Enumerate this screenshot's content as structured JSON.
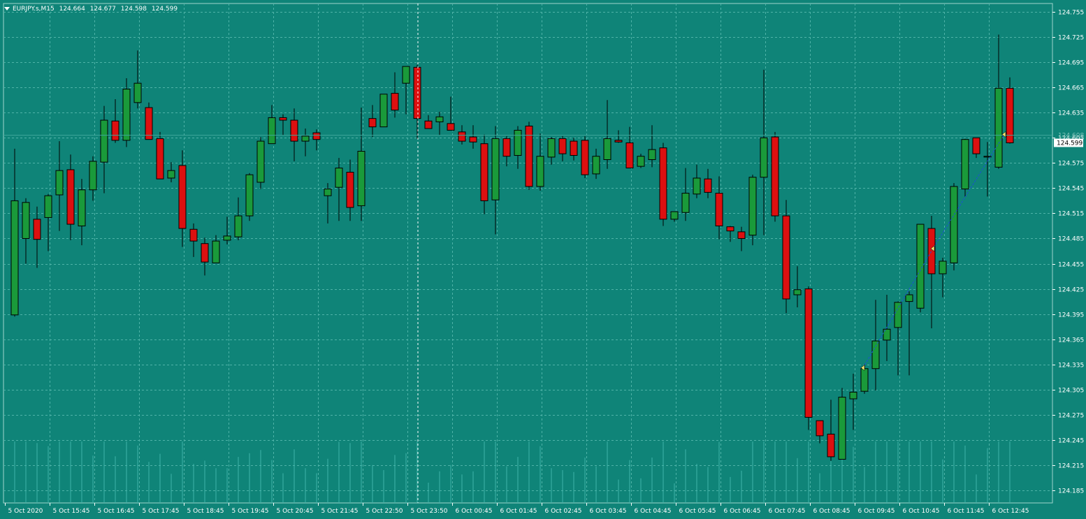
{
  "header": {
    "symbol": "EURJPY.s,M15",
    "open": "124.664",
    "high": "124.677",
    "low": "124.598",
    "close": "124.599"
  },
  "colors": {
    "background": "#0f8478",
    "bull": "#1a9a3a",
    "bear": "#dc1010",
    "outline": "#000000",
    "grid": "#4fb3a8",
    "volume": "#3fb5aa",
    "axis_text": "#ffffff",
    "price_line": "#3fa69a",
    "trend_line": "#1e4fd8",
    "arrow": "#f0e070"
  },
  "chart_data": {
    "type": "candlestick",
    "symbol": "EURJPY.s",
    "timeframe": "M15",
    "ylim": [
      124.17,
      124.765
    ],
    "yticks": [
      124.185,
      124.215,
      124.245,
      124.275,
      124.305,
      124.335,
      124.365,
      124.395,
      124.425,
      124.455,
      124.485,
      124.515,
      124.545,
      124.575,
      124.605,
      124.635,
      124.665,
      124.695,
      124.725,
      124.755
    ],
    "ytick_labels": [
      "124.185",
      "124.215",
      "124.245",
      "124.275",
      "124.305",
      "124.335",
      "124.365",
      "124.395",
      "124.425",
      "124.455",
      "124.485",
      "124.515",
      "124.545",
      "124.575",
      "124.605",
      "124.635",
      "124.665",
      "124.695",
      "124.725",
      "124.755"
    ],
    "xtick_labels": [
      "5 Oct 2020",
      "5 Oct 15:45",
      "5 Oct 16:45",
      "5 Oct 17:45",
      "5 Oct 18:45",
      "5 Oct 19:45",
      "5 Oct 20:45",
      "5 Oct 21:45",
      "5 Oct 22:50",
      "5 Oct 23:50",
      "6 Oct 00:45",
      "6 Oct 01:45",
      "6 Oct 02:45",
      "6 Oct 03:45",
      "6 Oct 04:45",
      "6 Oct 05:45",
      "6 Oct 06:45",
      "6 Oct 07:45",
      "6 Oct 08:45",
      "6 Oct 09:45",
      "6 Oct 10:45",
      "6 Oct 11:45",
      "6 Oct 12:45"
    ],
    "current_price": "124.599",
    "ask_price": "124.608",
    "candles": [
      [
        124.394,
        124.592,
        124.392,
        124.53
      ],
      [
        124.485,
        124.533,
        124.455,
        124.528
      ],
      [
        124.508,
        124.523,
        124.45,
        124.484
      ],
      [
        124.51,
        124.538,
        124.47,
        124.536
      ],
      [
        124.537,
        124.601,
        124.494,
        124.566
      ],
      [
        124.567,
        124.585,
        124.483,
        124.502
      ],
      [
        124.5,
        124.556,
        124.477,
        124.543
      ],
      [
        124.543,
        124.583,
        124.53,
        124.577
      ],
      [
        124.576,
        124.643,
        124.539,
        124.626
      ],
      [
        124.625,
        124.651,
        124.599,
        124.602
      ],
      [
        124.602,
        124.676,
        124.594,
        124.663
      ],
      [
        124.647,
        124.709,
        124.64,
        124.67
      ],
      [
        124.641,
        124.647,
        124.604,
        124.603
      ],
      [
        124.604,
        124.612,
        124.556,
        124.556
      ],
      [
        124.557,
        124.576,
        124.552,
        124.566
      ],
      [
        124.572,
        124.59,
        124.475,
        124.497
      ],
      [
        124.496,
        124.503,
        124.463,
        124.482
      ],
      [
        124.479,
        124.486,
        124.441,
        124.457
      ],
      [
        124.456,
        124.489,
        124.456,
        124.482
      ],
      [
        124.483,
        124.511,
        124.478,
        124.488
      ],
      [
        124.487,
        124.534,
        124.483,
        124.512
      ],
      [
        124.512,
        124.563,
        124.506,
        124.561
      ],
      [
        124.552,
        124.606,
        124.544,
        124.601
      ],
      [
        124.598,
        124.644,
        124.598,
        124.629
      ],
      [
        124.629,
        124.633,
        124.608,
        124.626
      ],
      [
        124.626,
        124.64,
        124.577,
        124.601
      ],
      [
        124.601,
        124.616,
        124.583,
        124.607
      ],
      [
        124.611,
        124.615,
        124.59,
        124.603
      ],
      [
        124.536,
        124.551,
        124.503,
        124.544
      ],
      [
        124.546,
        124.581,
        124.506,
        124.569
      ],
      [
        124.564,
        124.579,
        124.506,
        124.522
      ],
      [
        124.524,
        124.641,
        124.506,
        124.589
      ],
      [
        124.628,
        124.644,
        124.606,
        124.618
      ],
      [
        124.618,
        124.651,
        124.621,
        124.657
      ],
      [
        124.658,
        124.683,
        124.629,
        124.638
      ],
      [
        124.67,
        124.69,
        124.633,
        124.69
      ],
      [
        124.689,
        124.692,
        124.604,
        124.628
      ],
      [
        124.625,
        124.632,
        124.622,
        124.616
      ],
      [
        124.624,
        124.636,
        124.608,
        124.63
      ],
      [
        124.622,
        124.654,
        124.616,
        124.614
      ],
      [
        124.612,
        124.62,
        124.597,
        124.601
      ],
      [
        124.606,
        124.62,
        124.592,
        124.6
      ],
      [
        124.598,
        124.609,
        124.514,
        124.53
      ],
      [
        124.531,
        124.619,
        124.49,
        124.604
      ],
      [
        124.604,
        124.607,
        124.571,
        124.583
      ],
      [
        124.584,
        124.619,
        124.568,
        124.614
      ],
      [
        124.619,
        124.624,
        124.543,
        124.547
      ],
      [
        124.547,
        124.61,
        124.542,
        124.583
      ],
      [
        124.582,
        124.606,
        124.573,
        124.604
      ],
      [
        124.604,
        124.607,
        124.577,
        124.586
      ],
      [
        124.601,
        124.605,
        124.578,
        124.584
      ],
      [
        124.602,
        124.607,
        124.557,
        124.561
      ],
      [
        124.562,
        124.592,
        124.556,
        124.583
      ],
      [
        124.579,
        124.65,
        124.568,
        124.604
      ],
      [
        124.602,
        124.614,
        124.599,
        124.6
      ],
      [
        124.599,
        124.618,
        124.572,
        124.569
      ],
      [
        124.571,
        124.586,
        124.569,
        124.583
      ],
      [
        124.579,
        124.62,
        124.57,
        124.591
      ],
      [
        124.593,
        124.599,
        124.5,
        124.508
      ],
      [
        124.508,
        124.514,
        124.505,
        124.517
      ],
      [
        124.516,
        124.569,
        124.506,
        124.539
      ],
      [
        124.538,
        124.573,
        124.533,
        124.557
      ],
      [
        124.556,
        124.568,
        124.533,
        124.54
      ],
      [
        124.539,
        124.559,
        124.484,
        124.5
      ],
      [
        124.499,
        124.5,
        124.481,
        124.494
      ],
      [
        124.493,
        124.499,
        124.47,
        124.485
      ],
      [
        124.489,
        124.561,
        124.477,
        124.558
      ],
      [
        124.558,
        124.686,
        124.489,
        124.605
      ],
      [
        124.606,
        124.612,
        124.505,
        124.512
      ],
      [
        124.512,
        124.531,
        124.396,
        124.413
      ],
      [
        124.418,
        124.452,
        124.403,
        124.424
      ],
      [
        124.425,
        124.428,
        124.257,
        124.272
      ],
      [
        124.268,
        124.266,
        124.241,
        124.25
      ],
      [
        124.252,
        124.293,
        124.22,
        124.225
      ],
      [
        124.222,
        124.307,
        124.222,
        124.296
      ],
      [
        124.294,
        124.324,
        124.257,
        124.302
      ],
      [
        124.303,
        124.335,
        124.3,
        124.33
      ],
      [
        124.33,
        124.412,
        124.304,
        124.363
      ],
      [
        124.364,
        124.418,
        124.339,
        124.377
      ],
      [
        124.379,
        124.41,
        124.322,
        124.409
      ],
      [
        124.41,
        124.422,
        124.322,
        124.418
      ],
      [
        124.402,
        124.498,
        124.397,
        124.502
      ],
      [
        124.497,
        124.512,
        124.378,
        124.443
      ],
      [
        124.443,
        124.462,
        124.415,
        124.458
      ],
      [
        124.456,
        124.551,
        124.447,
        124.547
      ],
      [
        124.544,
        124.604,
        124.535,
        124.603
      ],
      [
        124.605,
        124.604,
        124.581,
        124.586
      ],
      [
        124.582,
        124.6,
        124.535,
        124.583
      ],
      [
        124.57,
        124.728,
        124.568,
        124.664
      ],
      [
        124.664,
        124.677,
        124.598,
        124.599
      ]
    ],
    "volume_profile": "tick_volume_bars_bottom"
  }
}
